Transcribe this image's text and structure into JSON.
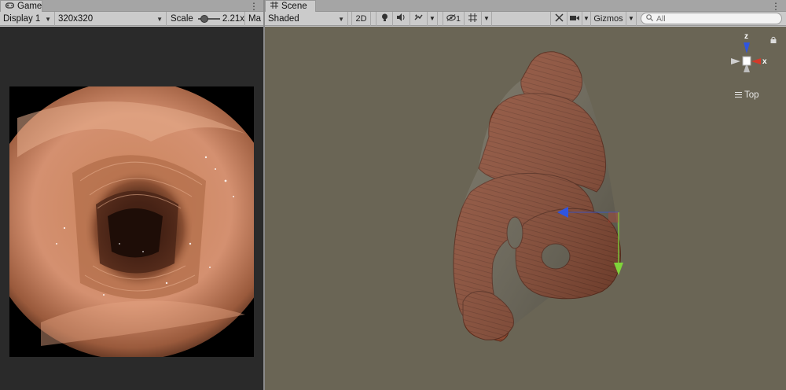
{
  "game": {
    "tab_label": "Game",
    "display": "Display 1",
    "resolution": "320x320",
    "scale_label": "Scale",
    "scale_value": "2.21x",
    "scale_level": 0.2,
    "maximize_partial": "Ma"
  },
  "scene": {
    "tab_label": "Scene",
    "draw_mode": "Shaded",
    "btn_2d": "2D",
    "hidden_count": "1",
    "gizmos_label": "Gizmos",
    "search_placeholder": "All",
    "orientation_label": "Top",
    "axis_z": "z",
    "axis_x": "x"
  },
  "colors": {
    "scene_background": "#6a6555",
    "game_background": "#2a2a2a",
    "tissue": "#8c4a32",
    "axis_x": "#d33a2a",
    "axis_y": "#7fd43a",
    "axis_z": "#2f55e0"
  },
  "icons": {
    "game_tab": "gamepad-icon",
    "scene_tab": "grid-icon",
    "lighting": "lightbulb-icon",
    "audio": "speaker-icon",
    "effects": "effects-icon",
    "visibility": "eye-slash-icon",
    "grid": "grid-snap-icon",
    "tools": "tools-icon",
    "camera": "camera-icon",
    "search": "search-icon",
    "lock": "lock-icon",
    "menu": "kebab-menu-icon"
  }
}
